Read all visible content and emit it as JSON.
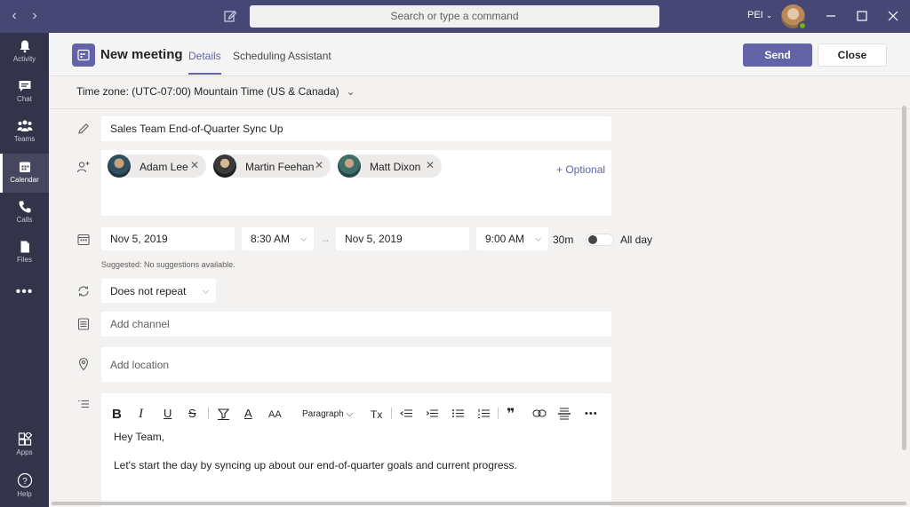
{
  "search": {
    "placeholder": "Search or type a command"
  },
  "user": {
    "initials": "PEI",
    "presence_color": "#6bb700"
  },
  "rail": {
    "items": [
      {
        "label": "Activity",
        "icon": "bell-icon"
      },
      {
        "label": "Chat",
        "icon": "chat-icon"
      },
      {
        "label": "Teams",
        "icon": "teams-icon"
      },
      {
        "label": "Calendar",
        "icon": "calendar-icon",
        "active": true
      },
      {
        "label": "Calls",
        "icon": "phone-icon"
      },
      {
        "label": "Files",
        "icon": "file-icon"
      }
    ],
    "more": "•••",
    "bottom": [
      {
        "label": "Apps",
        "icon": "apps-icon"
      },
      {
        "label": "Help",
        "icon": "help-icon"
      }
    ]
  },
  "header": {
    "title": "New meeting",
    "tabs": [
      "Details",
      "Scheduling Assistant"
    ],
    "send_label": "Send",
    "close_label": "Close"
  },
  "timezone": "Time zone: (UTC-07:00) Mountain Time (US & Canada)",
  "form": {
    "title_value": "Sales Team End-of-Quarter Sync Up",
    "attendees": [
      {
        "name": "Adam Lee"
      },
      {
        "name": "Martin Feehan"
      },
      {
        "name": "Matt Dixon"
      }
    ],
    "optional_label": "+ Optional",
    "start_date": "Nov 5, 2019",
    "start_time": "8:30 AM",
    "end_date": "Nov 5, 2019",
    "end_time": "9:00 AM",
    "duration": "30m",
    "all_day_label": "All day",
    "all_day_on": false,
    "suggestion": "Suggested: No suggestions available.",
    "repeat": "Does not repeat",
    "channel_placeholder": "Add channel",
    "location_placeholder": "Add location"
  },
  "editor": {
    "toolbar": {
      "bold": "B",
      "italic": "I",
      "underline": "U",
      "strike": "S",
      "font_color": "A",
      "font_size": "AA",
      "paragraph": "Paragraph",
      "clear_format": "Tx",
      "quote": "❞",
      "more": "•••"
    },
    "body": [
      "Hey Team,",
      "Let's start the day by syncing up about our end-of-quarter goals and current progress."
    ]
  },
  "colors": {
    "brand": "#6264a7",
    "titlebar": "#464775",
    "rail": "#33344a"
  }
}
